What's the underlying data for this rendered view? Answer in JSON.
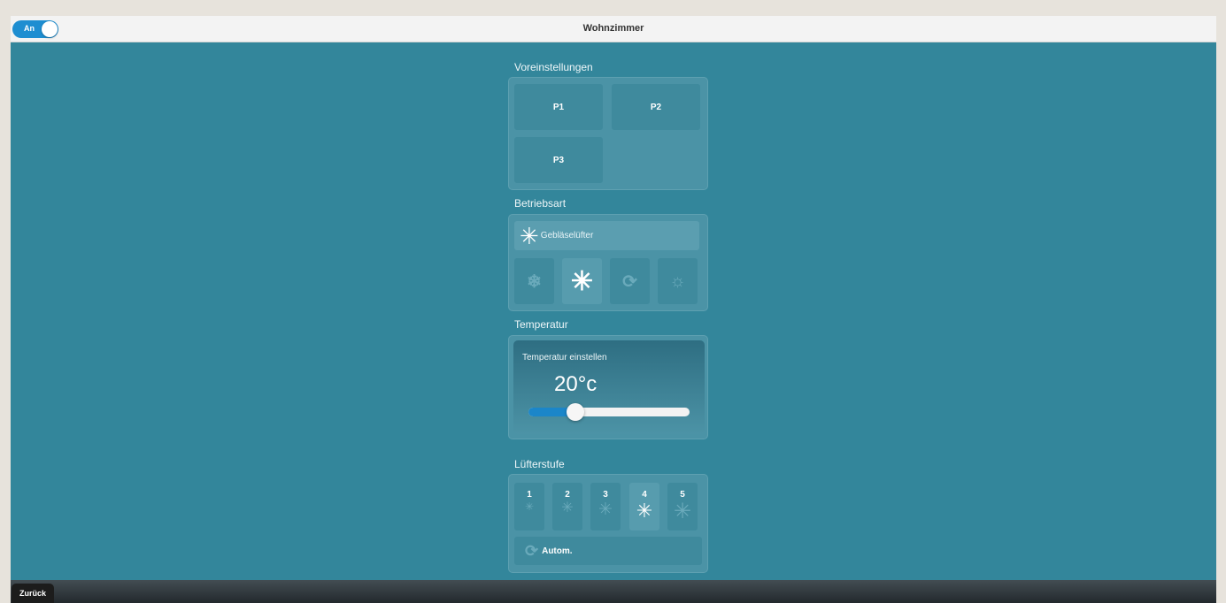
{
  "header": {
    "title": "Wohnzimmer",
    "power_toggle": {
      "label": "An",
      "state": "on"
    }
  },
  "presets": {
    "title": "Voreinstellungen",
    "buttons": [
      "P1",
      "P2",
      "P3"
    ]
  },
  "mode": {
    "title": "Betriebsart",
    "current_label": "Gebläselüfter",
    "current_icon": "fan-icon",
    "options": [
      {
        "icon": "snowflake-icon",
        "glyph": "❄",
        "active": false
      },
      {
        "icon": "fan-icon",
        "glyph": "✳",
        "active": true
      },
      {
        "icon": "auto-cycle-icon",
        "glyph": "⟳",
        "active": false
      },
      {
        "icon": "sun-icon",
        "glyph": "☼",
        "active": false
      }
    ]
  },
  "temperature": {
    "title": "Temperatur",
    "set_label": "Temperatur einstellen",
    "value_text": "20°c",
    "slider_fraction": 0.29
  },
  "fan": {
    "title": "Lüfterstufe",
    "levels": [
      "1",
      "2",
      "3",
      "4",
      "5"
    ],
    "active_level": "4",
    "auto_label": "Autom."
  },
  "footer": {
    "back_label": "Zurück"
  },
  "colors": {
    "background": "#33869b",
    "accent": "#1e8ed1"
  }
}
